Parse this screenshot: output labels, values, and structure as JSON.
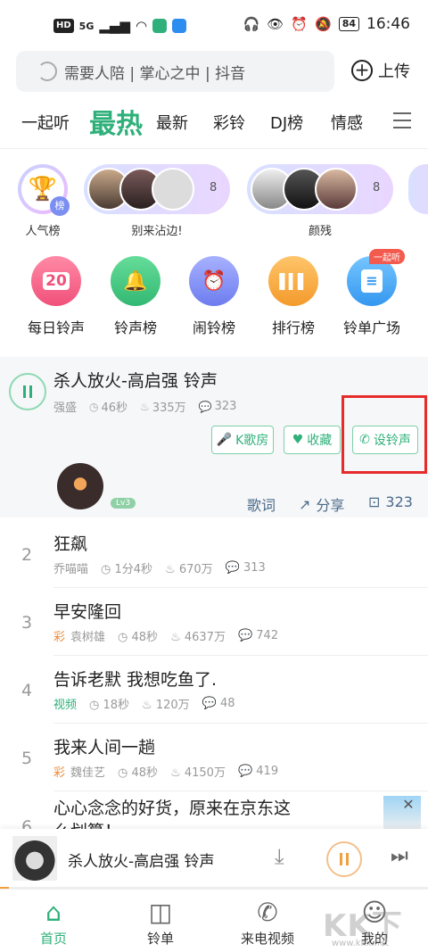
{
  "status_bar": {
    "hd": "HD",
    "network": "5G",
    "battery": "84",
    "time": "16:46"
  },
  "search": {
    "placeholder": "需要人陪 | 掌心之中 | 抖音",
    "upload_label": "上传"
  },
  "tabs": [
    "一起听",
    "最热",
    "最新",
    "彩铃",
    "DJ榜",
    "情感"
  ],
  "active_tab": "最热",
  "avatar_row": [
    {
      "label": "人气榜",
      "badge": "榜"
    },
    {
      "label": "别来沾边!",
      "count": "8"
    },
    {
      "label": "颜残",
      "count": "8"
    }
  ],
  "categories": [
    {
      "label": "每日铃声",
      "glyph": "20",
      "color": "#f15b7f"
    },
    {
      "label": "铃声榜",
      "glyph": "🔔",
      "color": "#3ec47c"
    },
    {
      "label": "闹铃榜",
      "glyph": "⏰",
      "color": "#7f8cf0"
    },
    {
      "label": "排行榜",
      "glyph": "▮▮▮",
      "color": "#f5a43f"
    },
    {
      "label": "铃单广场",
      "glyph": "▤",
      "color": "#3fa6f0"
    }
  ],
  "new_badge": "一起听",
  "featured": {
    "title": "杀人放火-高启强 铃声",
    "artist": "强盛",
    "duration": "46秒",
    "plays": "335万",
    "comments": "323",
    "btn_k": "K歌房",
    "btn_fav": "收藏",
    "btn_set": "设铃声",
    "level": "Lv3",
    "lyrics": "歌词",
    "share": "分享",
    "comment_count": "323"
  },
  "list": [
    {
      "rank": "2",
      "title": "狂飙",
      "tag": "",
      "artist": "乔喵喵",
      "duration": "1分4秒",
      "plays": "670万",
      "comments": "313"
    },
    {
      "rank": "3",
      "title": "早安隆回",
      "tag": "彩",
      "artist": "袁树雄",
      "duration": "48秒",
      "plays": "4637万",
      "comments": "742"
    },
    {
      "rank": "4",
      "title": "告诉老默 我想吃鱼了.",
      "tag": "视频",
      "artist": "",
      "duration": "18秒",
      "plays": "120万",
      "comments": "48"
    },
    {
      "rank": "5",
      "title": "我来人间一趟",
      "tag": "彩",
      "artist": "魏佳艺",
      "duration": "48秒",
      "plays": "4150万",
      "comments": "419"
    }
  ],
  "ad": {
    "rank": "6",
    "title": "心心念念的好货，原来在京东这么划算！"
  },
  "player": {
    "title": "杀人放火-高启强 铃声",
    "progress": 0.02
  },
  "nav": [
    {
      "label": "首页",
      "icon": "home-icon"
    },
    {
      "label": "铃单",
      "icon": "playlist-icon"
    },
    {
      "label": "来电视频",
      "icon": "phone-video-icon"
    },
    {
      "label": "我的",
      "icon": "profile-icon"
    }
  ],
  "watermark": "KK下载",
  "watermark_url": "www.kkx.net"
}
